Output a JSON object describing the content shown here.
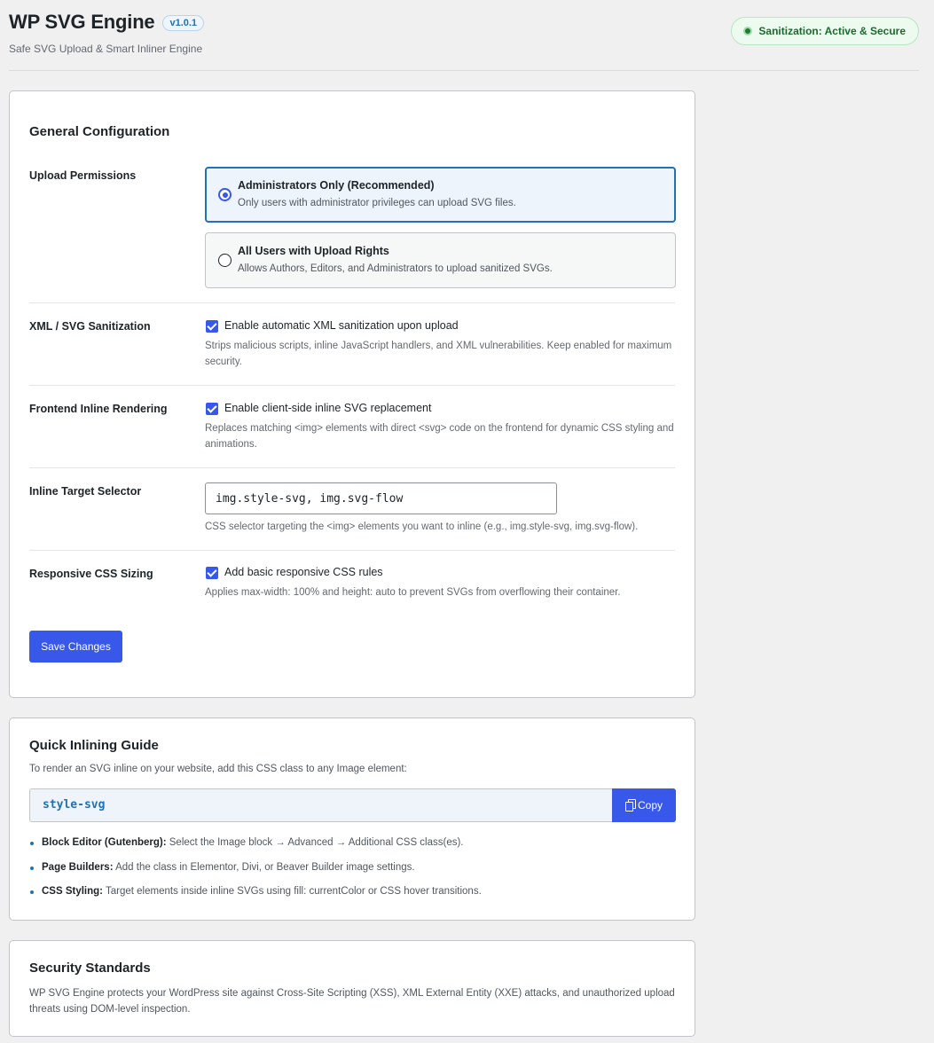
{
  "header": {
    "title": "WP SVG Engine",
    "version": "v1.0.1",
    "subtitle": "Safe SVG Upload & Smart Inliner Engine",
    "status": "Sanitization: Active & Secure"
  },
  "general": {
    "title": "General Configuration",
    "upload_permissions": {
      "label": "Upload Permissions",
      "options": [
        {
          "title": "Administrators Only (Recommended)",
          "desc": "Only users with administrator privileges can upload SVG files.",
          "selected": true
        },
        {
          "title": "All Users with Upload Rights",
          "desc": "Allows Authors, Editors, and Administrators to upload sanitized SVGs.",
          "selected": false
        }
      ]
    },
    "sanitization": {
      "label": "XML / SVG Sanitization",
      "checkbox_label": "Enable automatic XML sanitization upon upload",
      "checked": true,
      "help": "Strips malicious scripts, inline JavaScript handlers, and XML vulnerabilities. Keep enabled for maximum security."
    },
    "inline_rendering": {
      "label": "Frontend Inline Rendering",
      "checkbox_label": "Enable client-side inline SVG replacement",
      "checked": true,
      "help": "Replaces matching <img> elements with direct <svg> code on the frontend for dynamic CSS styling and animations."
    },
    "target_selector": {
      "label": "Inline Target Selector",
      "value": "img.style-svg, img.svg-flow",
      "help": "CSS selector targeting the <img> elements you want to inline (e.g., img.style-svg, img.svg-flow)."
    },
    "responsive": {
      "label": "Responsive CSS Sizing",
      "checkbox_label": "Add basic responsive CSS rules",
      "checked": true,
      "help": "Applies max-width: 100% and height: auto to prevent SVGs from overflowing their container."
    },
    "save_label": "Save Changes"
  },
  "guide": {
    "title": "Quick Inlining Guide",
    "desc": "To render an SVG inline on your website, add this CSS class to any Image element:",
    "code": "style-svg",
    "copy_label": "Copy",
    "items": [
      {
        "bold": "Block Editor (Gutenberg):",
        "text": " Select the Image block → Advanced → Additional CSS class(es)."
      },
      {
        "bold": "Page Builders:",
        "text": " Add the class in Elementor, Divi, or Beaver Builder image settings."
      },
      {
        "bold": "CSS Styling:",
        "text": " Target elements inside inline SVGs using fill: currentColor or CSS hover transitions."
      }
    ]
  },
  "security": {
    "title": "Security Standards",
    "text": "WP SVG Engine protects your WordPress site against Cross-Site Scripting (XSS), XML External Entity (XXE) attacks, and unauthorized upload threats using DOM-level inspection."
  },
  "colors": {
    "accent": "#3858e9",
    "link": "#2271b1",
    "success_bg": "#edfaef",
    "success_text": "#1a6b2b"
  },
  "icons": {
    "copy": "copy-icon",
    "status": "status-dot-icon"
  }
}
